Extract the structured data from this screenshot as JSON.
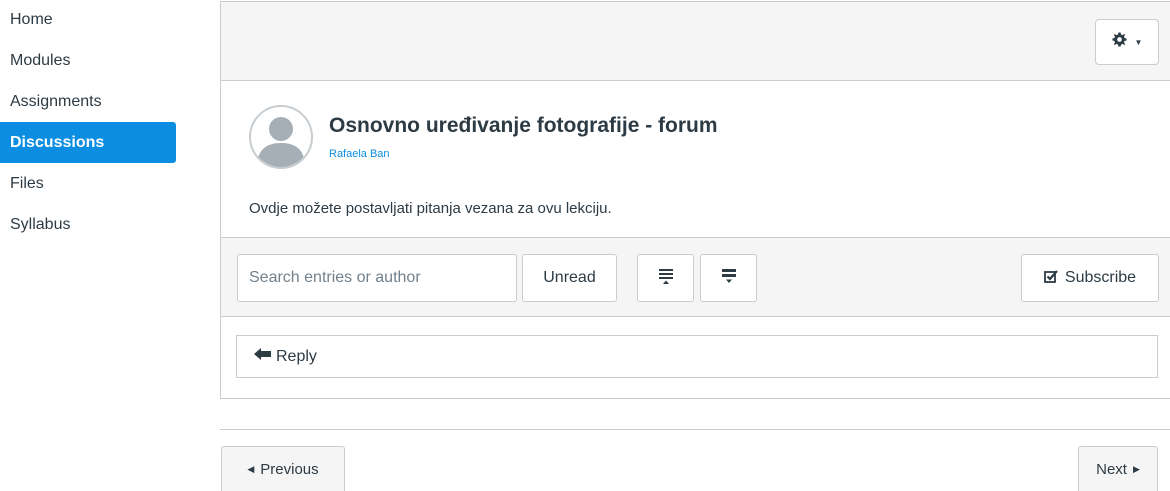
{
  "sidebar": {
    "items": [
      {
        "label": "Home"
      },
      {
        "label": "Modules"
      },
      {
        "label": "Assignments"
      },
      {
        "label": "Discussions",
        "active": true
      },
      {
        "label": "Files"
      },
      {
        "label": "Syllabus"
      }
    ]
  },
  "header": {
    "settings_icon": "gear-icon",
    "settings_caret": "▼"
  },
  "topic": {
    "title": "Osnovno uređivanje fotografije - forum",
    "author": "Rafaela Ban",
    "message": "Ovdje možete postavljati pitanja vezana za ovu lekciju."
  },
  "toolbar": {
    "search_placeholder": "Search entries or author",
    "unread_label": "Unread",
    "subscribe_label": "Subscribe"
  },
  "reply": {
    "label": "Reply"
  },
  "footer": {
    "previous_label": "Previous",
    "next_label": "Next"
  },
  "colors": {
    "accent": "#0b8ee2",
    "text": "#2d3b45",
    "border": "#c7cdd1",
    "toolbar_bg": "#f5f5f5"
  }
}
